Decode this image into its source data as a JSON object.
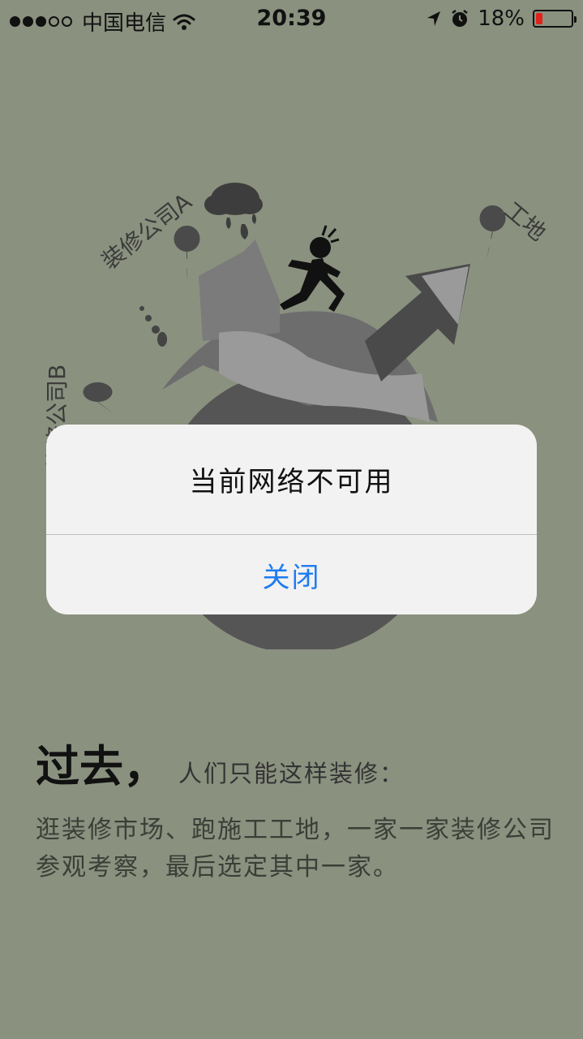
{
  "status_bar": {
    "carrier": "中国电信",
    "time": "20:39",
    "battery": "18%",
    "battery_level": 0.18,
    "signal_bars_on": 3,
    "signal_bars_total": 5,
    "icons": [
      "wifi-icon",
      "location-arrow-icon",
      "alarm-icon",
      "battery-icon"
    ]
  },
  "illustration": {
    "label_company_a": "装修公司A",
    "label_company_b": "装修公司B",
    "label_site": "工地"
  },
  "content": {
    "headline_big": "过去，",
    "headline_small": "人们只能这样装修：",
    "description": "逛装修市场、跑施工工地，一家一家装修公司参观考察，最后选定其中一家。"
  },
  "alert": {
    "title": "当前网络不可用",
    "close_label": "关闭"
  },
  "colors": {
    "background": "#8a917f",
    "alert_bg": "#f2f2f2",
    "button_blue": "#1e7cf2",
    "battery_red": "#e0221a"
  }
}
